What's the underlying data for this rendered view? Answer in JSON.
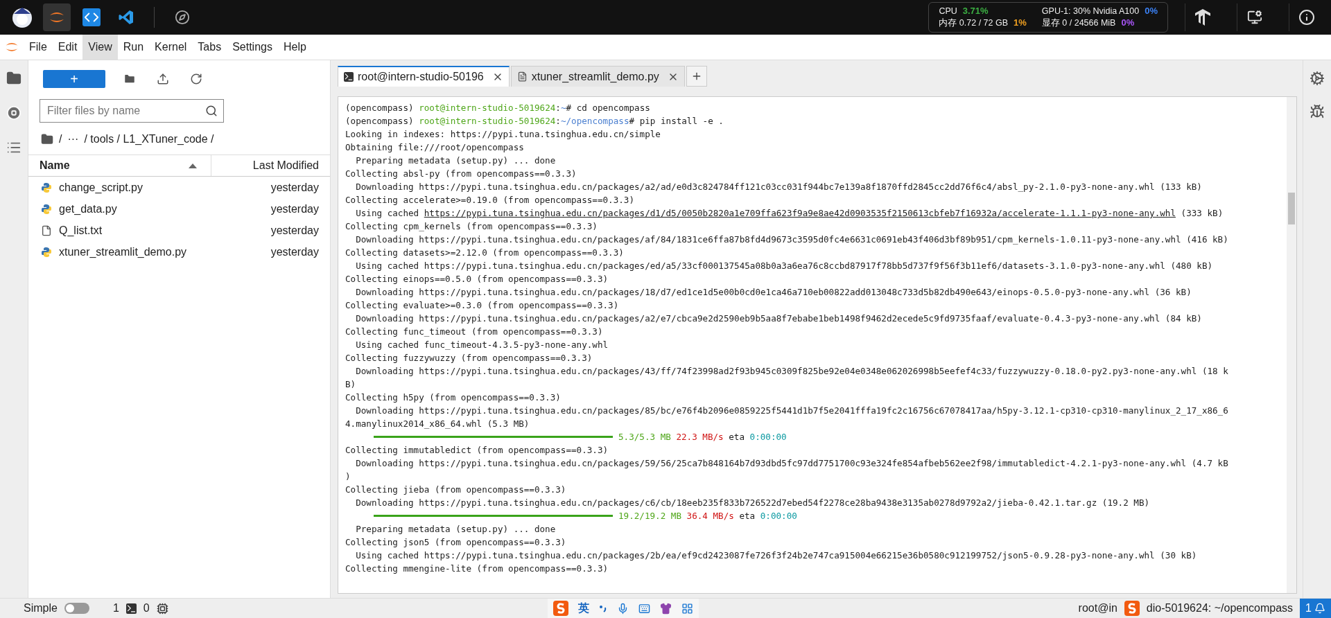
{
  "top_bar": {
    "apps": [
      {
        "kind": "mascot",
        "selected": false
      },
      {
        "kind": "jupyter",
        "selected": true
      },
      {
        "kind": "code",
        "selected": false
      },
      {
        "kind": "vscode",
        "selected": false
      },
      {
        "kind": "compass",
        "selected": false
      }
    ],
    "metrics": [
      {
        "label": "CPU",
        "value": "3.71%",
        "color": "#3cb043"
      },
      {
        "label": "GPU-1: 30% Nvidia A100",
        "value": "0%",
        "color": "#3b82f6"
      },
      {
        "label": "内存 0.72 / 72 GB",
        "value": "1%",
        "color": "#f0a020"
      },
      {
        "label": "显存 0 / 24566 MiB",
        "value": "0%",
        "color": "#a855f7"
      }
    ]
  },
  "menu": [
    {
      "label": "File",
      "selected": false
    },
    {
      "label": "Edit",
      "selected": false
    },
    {
      "label": "View",
      "selected": true
    },
    {
      "label": "Run",
      "selected": false
    },
    {
      "label": "Kernel",
      "selected": false
    },
    {
      "label": "Tabs",
      "selected": false
    },
    {
      "label": "Settings",
      "selected": false
    },
    {
      "label": "Help",
      "selected": false
    }
  ],
  "left_sidebar": [
    {
      "kind": "folder",
      "selected": true
    },
    {
      "kind": "stop",
      "selected": false
    },
    {
      "kind": "list",
      "selected": false
    }
  ],
  "file_browser": {
    "new_button": "+",
    "filter": {
      "placeholder": "Filter files by name"
    },
    "breadcrumb": [
      "/",
      "···",
      "/ tools / L1_XTuner_code /"
    ],
    "columns": [
      "Name",
      "Last Modified"
    ],
    "files": [
      {
        "name": "change_script.py",
        "kind": "python",
        "modified": "yesterday"
      },
      {
        "name": "get_data.py",
        "kind": "python",
        "modified": "yesterday"
      },
      {
        "name": "Q_list.txt",
        "kind": "text",
        "modified": "yesterday"
      },
      {
        "name": "xtuner_streamlit_demo.py",
        "kind": "python",
        "modified": "yesterday"
      }
    ]
  },
  "tabs": [
    {
      "label": "root@intern-studio-50196",
      "kind": "terminal",
      "selected": true
    },
    {
      "label": "xtuner_streamlit_demo.py",
      "kind": "file",
      "selected": false
    }
  ],
  "terminal": [
    {
      "segments": [
        {
          "text": "(opencompass) ",
          "kind": "plain"
        },
        {
          "text": "root@intern-studio-5019624",
          "kind": "user"
        },
        {
          "text": ":",
          "kind": "plain"
        },
        {
          "text": "~",
          "kind": "path"
        },
        {
          "text": "# cd opencompass",
          "kind": "plain"
        }
      ]
    },
    {
      "segments": [
        {
          "text": "(opencompass) ",
          "kind": "plain"
        },
        {
          "text": "root@intern-studio-5019624",
          "kind": "user"
        },
        {
          "text": ":",
          "kind": "plain"
        },
        {
          "text": "~/opencompass",
          "kind": "path"
        },
        {
          "text": "# pip install -e .",
          "kind": "plain"
        }
      ]
    },
    {
      "segments": [
        {
          "text": "Looking in indexes: https://pypi.tuna.tsinghua.edu.cn/simple",
          "kind": "plain"
        }
      ]
    },
    {
      "segments": [
        {
          "text": "Obtaining file:///root/opencompass",
          "kind": "plain"
        }
      ]
    },
    {
      "segments": [
        {
          "text": "  Preparing metadata (setup.py) ... done",
          "kind": "plain"
        }
      ]
    },
    {
      "segments": [
        {
          "text": "Collecting absl-py (from opencompass==0.3.3)",
          "kind": "plain"
        }
      ]
    },
    {
      "segments": [
        {
          "text": "  Downloading https://pypi.tuna.tsinghua.edu.cn/packages/a2/ad/e0d3c824784ff121c03cc031f944bc7e139a8f1870ffd2845cc2dd76f6c4/absl_py-2.1.0-py3-none-any.whl (133 kB)",
          "kind": "plain"
        }
      ]
    },
    {
      "segments": [
        {
          "text": "Collecting accelerate>=0.19.0 (from opencompass==0.3.3)",
          "kind": "plain"
        }
      ]
    },
    {
      "segments": [
        {
          "text": "  Using cached ",
          "kind": "plain"
        },
        {
          "text": "https://pypi.tuna.tsinghua.edu.cn/packages/d1/d5/0050b2820a1e709ffa623f9a9e8ae42d0903535f2150613cbfeb7f16932a/accelerate-1.1.1-py3-none-any.whl",
          "kind": "link"
        },
        {
          "text": " (333 kB)",
          "kind": "plain"
        }
      ]
    },
    {
      "segments": [
        {
          "text": "Collecting cpm_kernels (from opencompass==0.3.3)",
          "kind": "plain"
        }
      ]
    },
    {
      "segments": [
        {
          "text": "  Downloading https://pypi.tuna.tsinghua.edu.cn/packages/af/84/1831ce6ffa87b8fd4d9673c3595d0fc4e6631c0691eb43f406d3bf89b951/cpm_kernels-1.0.11-py3-none-any.whl (416 kB)",
          "kind": "plain"
        }
      ]
    },
    {
      "segments": [
        {
          "text": "Collecting datasets>=2.12.0 (from opencompass==0.3.3)",
          "kind": "plain"
        }
      ]
    },
    {
      "segments": [
        {
          "text": "  Using cached https://pypi.tuna.tsinghua.edu.cn/packages/ed/a5/33cf000137545a08b0a3a6ea76c8ccbd87917f78bb5d737f9f56f3b11ef6/datasets-3.1.0-py3-none-any.whl (480 kB)",
          "kind": "plain"
        }
      ]
    },
    {
      "segments": [
        {
          "text": "Collecting einops==0.5.0 (from opencompass==0.3.3)",
          "kind": "plain"
        }
      ]
    },
    {
      "segments": [
        {
          "text": "  Downloading https://pypi.tuna.tsinghua.edu.cn/packages/18/d7/ed1ce1d5e00b0cd0e1ca46a710eb00822add013048c733d5b82db490e643/einops-0.5.0-py3-none-any.whl (36 kB)",
          "kind": "plain"
        }
      ]
    },
    {
      "segments": [
        {
          "text": "Collecting evaluate>=0.3.0 (from opencompass==0.3.3)",
          "kind": "plain"
        }
      ]
    },
    {
      "segments": [
        {
          "text": "  Downloading https://pypi.tuna.tsinghua.edu.cn/packages/a2/e7/cbca9e2d2590eb9b5aa8f7ebabe1beb1498f9462d2ecede5c9fd9735faaf/evaluate-0.4.3-py3-none-any.whl (84 kB)",
          "kind": "plain"
        }
      ]
    },
    {
      "segments": [
        {
          "text": "Collecting func_timeout (from opencompass==0.3.3)",
          "kind": "plain"
        }
      ]
    },
    {
      "segments": [
        {
          "text": "  Using cached func_timeout-4.3.5-py3-none-any.whl",
          "kind": "plain"
        }
      ]
    },
    {
      "segments": [
        {
          "text": "Collecting fuzzywuzzy (from opencompass==0.3.3)",
          "kind": "plain"
        }
      ]
    },
    {
      "segments": [
        {
          "text": "  Downloading https://pypi.tuna.tsinghua.edu.cn/packages/43/ff/74f23998ad2f93b945c0309f825be92e04e0348e062026998b5eefef4c33/fuzzywuzzy-0.18.0-py2.py3-none-any.whl (18 k",
          "kind": "plain"
        }
      ]
    },
    {
      "segments": [
        {
          "text": "B)",
          "kind": "plain"
        }
      ]
    },
    {
      "segments": [
        {
          "text": "Collecting h5py (from opencompass==0.3.3)",
          "kind": "plain"
        }
      ]
    },
    {
      "segments": [
        {
          "text": "  Downloading https://pypi.tuna.tsinghua.edu.cn/packages/85/bc/e76f4b2096e0859225f5441d1b7f5e2041fffa19fc2c16756c67078417aa/h5py-3.12.1-cp310-cp310-manylinux_2_17_x86_6",
          "kind": "plain"
        }
      ]
    },
    {
      "segments": [
        {
          "text": "4.manylinux2014_x86_64.whl (5.3 MB)",
          "kind": "plain"
        }
      ]
    },
    {
      "kind": "progress",
      "level": 1,
      "segments": [
        {
          "text": "5.3/5.3 MB",
          "kind": "size"
        },
        {
          "text": " 22.3 MB/s",
          "kind": "speed"
        },
        {
          "text": " eta ",
          "kind": "plain"
        },
        {
          "text": "0:00:00",
          "kind": "time"
        }
      ]
    },
    {
      "segments": [
        {
          "text": "Collecting immutabledict (from opencompass==0.3.3)",
          "kind": "plain"
        }
      ]
    },
    {
      "segments": [
        {
          "text": "  Downloading https://pypi.tuna.tsinghua.edu.cn/packages/59/56/25ca7b848164b7d93dbd5fc97dd7751700c93e324fe854afbeb562ee2f98/immutabledict-4.2.1-py3-none-any.whl (4.7 kB",
          "kind": "plain"
        }
      ]
    },
    {
      "segments": [
        {
          "text": ")",
          "kind": "plain"
        }
      ]
    },
    {
      "segments": [
        {
          "text": "Collecting jieba (from opencompass==0.3.3)",
          "kind": "plain"
        }
      ]
    },
    {
      "segments": [
        {
          "text": "  Downloading https://pypi.tuna.tsinghua.edu.cn/packages/c6/cb/18eeb235f833b726522d7ebed54f2278ce28ba9438e3135ab0278d9792a2/jieba-0.42.1.tar.gz (19.2 MB)",
          "kind": "plain"
        }
      ]
    },
    {
      "kind": "progress",
      "level": 1,
      "segments": [
        {
          "text": "19.2/19.2 MB",
          "kind": "size"
        },
        {
          "text": " 36.4 MB/s",
          "kind": "speed"
        },
        {
          "text": " eta ",
          "kind": "plain"
        },
        {
          "text": "0:00:00",
          "kind": "time"
        }
      ]
    },
    {
      "segments": [
        {
          "text": "  Preparing metadata (setup.py) ... done",
          "kind": "plain"
        }
      ]
    },
    {
      "segments": [
        {
          "text": "Collecting json5 (from opencompass==0.3.3)",
          "kind": "plain"
        }
      ]
    },
    {
      "segments": [
        {
          "text": "  Using cached https://pypi.tuna.tsinghua.edu.cn/packages/2b/ea/ef9cd2423087fe726f3f24b2e747ca915004e66215e36b0580c912199752/json5-0.9.28-py3-none-any.whl (30 kB)",
          "kind": "plain"
        }
      ]
    },
    {
      "segments": [
        {
          "text": "Collecting mmengine-lite (from opencompass==0.3.3)",
          "kind": "plain"
        }
      ]
    }
  ],
  "right_sidebar": [
    {
      "kind": "gears"
    },
    {
      "kind": "bug"
    }
  ],
  "ime_toolbar": {
    "mode": "英"
  },
  "status_bar": {
    "mode_label": "Simple",
    "simple_on": false,
    "terminals": "1",
    "kernels": "0",
    "path_left": "root@in",
    "path_right": "dio-5019624: ~/opencompass",
    "notifications": "1"
  }
}
